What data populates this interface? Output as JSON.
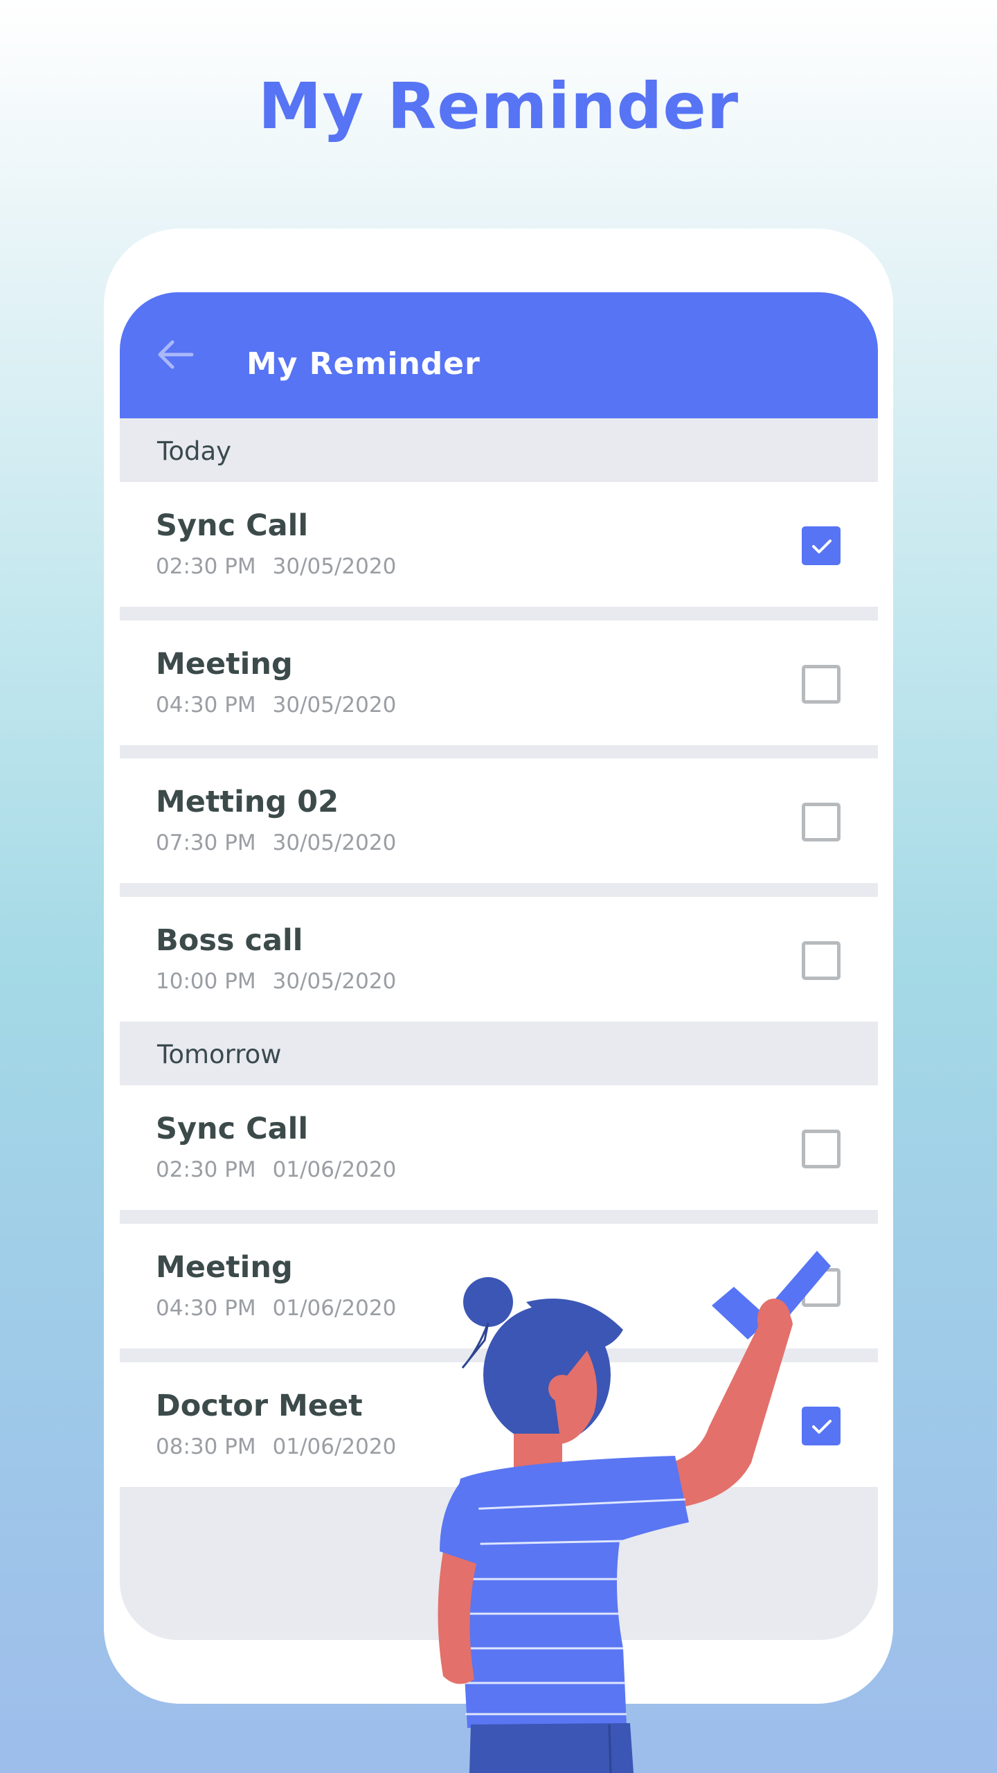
{
  "promo": {
    "title": "My Reminder"
  },
  "app_bar": {
    "title": "My Reminder",
    "back_icon": "arrow-left-icon"
  },
  "colors": {
    "accent": "#5774f4",
    "row_bg": "#ffffff",
    "divider": "#e8eaef"
  },
  "sections": [
    {
      "label": "Today",
      "items": [
        {
          "title": "Sync Call",
          "time": "02:30 PM",
          "date": "30/05/2020",
          "checked": true
        },
        {
          "title": "Meeting",
          "time": "04:30 PM",
          "date": "30/05/2020",
          "checked": false
        },
        {
          "title": "Metting 02",
          "time": "07:30 PM",
          "date": "30/05/2020",
          "checked": false
        },
        {
          "title": "Boss call",
          "time": "10:00 PM",
          "date": "30/05/2020",
          "checked": false
        }
      ]
    },
    {
      "label": "Tomorrow",
      "items": [
        {
          "title": "Sync Call",
          "time": "02:30 PM",
          "date": "01/06/2020",
          "checked": false
        },
        {
          "title": "Meeting",
          "time": "04:30 PM",
          "date": "01/06/2020",
          "checked": false
        },
        {
          "title": "Doctor Meet",
          "time": "08:30 PM",
          "date": "01/06/2020",
          "checked": true
        }
      ]
    }
  ]
}
